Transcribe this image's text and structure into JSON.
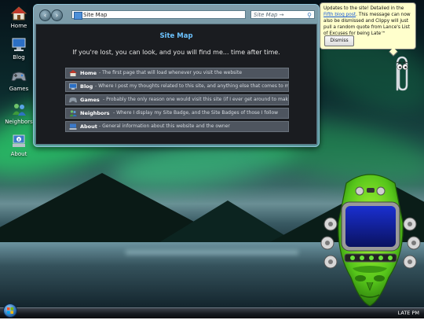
{
  "desktop": {
    "icons": [
      {
        "label": "Home",
        "icon": "house-icon"
      },
      {
        "label": "Blog",
        "icon": "monitor-icon"
      },
      {
        "label": "Games",
        "icon": "gamepad-icon"
      },
      {
        "label": "Neighbors",
        "icon": "people-icon"
      },
      {
        "label": "About",
        "icon": "info-computer-icon"
      }
    ]
  },
  "window": {
    "address": "Site Map",
    "search_placeholder": "Site Map →",
    "title": "Site Map",
    "subtitle": "If you're lost, you can look, and you will find me... time after time.",
    "items": [
      {
        "name": "Home",
        "desc": "- The first page that will load whenever you visit the website"
      },
      {
        "name": "Blog",
        "desc": "- Where I post my thoughts related to this site, and anything else that comes to mind"
      },
      {
        "name": "Games",
        "desc": "- Probably the only reason one would visit this site (if I ever get around to making games)"
      },
      {
        "name": "Neighbors",
        "desc": "- Where I display my Site Badge, and the Site Badges of those I follow"
      },
      {
        "name": "About",
        "desc": "- General information about this website and the owner"
      }
    ]
  },
  "balloon": {
    "text_before": "Updates to the site! Detailed in the ",
    "link_text": "Fifth blog post",
    "text_after": ". This message can now also be dismissed and Clippy will just pull a random quote from Lance's List of Excuses for being Late™",
    "dismiss_label": "Dismiss"
  },
  "taskbar": {
    "clock": "LATE PM"
  },
  "colors": {
    "accent_title": "#6cc3ff",
    "balloon_bg": "#ffffcc",
    "link": "#1a5bd6"
  }
}
